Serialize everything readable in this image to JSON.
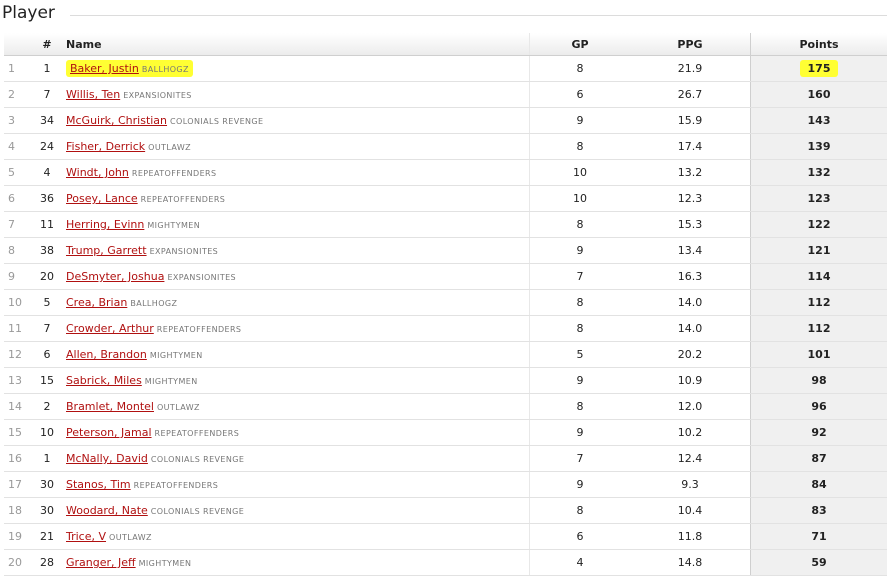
{
  "section": {
    "title": "Player"
  },
  "columns": {
    "idx": "",
    "num": "#",
    "name": "Name",
    "gp": "GP",
    "ppg": "PPG",
    "points": "Points"
  },
  "rows": [
    {
      "idx": "1",
      "num": "1",
      "name": "Baker, Justin",
      "team": "BALLHOGZ",
      "gp": "8",
      "ppg": "21.9",
      "points": "175",
      "highlight": true
    },
    {
      "idx": "2",
      "num": "7",
      "name": "Willis, Ten",
      "team": "EXPANSIONITES",
      "gp": "6",
      "ppg": "26.7",
      "points": "160"
    },
    {
      "idx": "3",
      "num": "34",
      "name": "McGuirk, Christian",
      "team": "COLONIALS REVENGE",
      "gp": "9",
      "ppg": "15.9",
      "points": "143"
    },
    {
      "idx": "4",
      "num": "24",
      "name": "Fisher, Derrick",
      "team": "OUTLAWZ",
      "gp": "8",
      "ppg": "17.4",
      "points": "139"
    },
    {
      "idx": "5",
      "num": "4",
      "name": "Windt, John",
      "team": "REPEATOFFENDERS",
      "gp": "10",
      "ppg": "13.2",
      "points": "132"
    },
    {
      "idx": "6",
      "num": "36",
      "name": "Posey, Lance",
      "team": "REPEATOFFENDERS",
      "gp": "10",
      "ppg": "12.3",
      "points": "123"
    },
    {
      "idx": "7",
      "num": "11",
      "name": "Herring, Evinn",
      "team": "MIGHTYMEN",
      "gp": "8",
      "ppg": "15.3",
      "points": "122"
    },
    {
      "idx": "8",
      "num": "38",
      "name": "Trump, Garrett",
      "team": "EXPANSIONITES",
      "gp": "9",
      "ppg": "13.4",
      "points": "121"
    },
    {
      "idx": "9",
      "num": "20",
      "name": "DeSmyter, Joshua",
      "team": "EXPANSIONITES",
      "gp": "7",
      "ppg": "16.3",
      "points": "114"
    },
    {
      "idx": "10",
      "num": "5",
      "name": "Crea, Brian",
      "team": "BALLHOGZ",
      "gp": "8",
      "ppg": "14.0",
      "points": "112"
    },
    {
      "idx": "11",
      "num": "7",
      "name": "Crowder, Arthur",
      "team": "REPEATOFFENDERS",
      "gp": "8",
      "ppg": "14.0",
      "points": "112"
    },
    {
      "idx": "12",
      "num": "6",
      "name": "Allen, Brandon",
      "team": "MIGHTYMEN",
      "gp": "5",
      "ppg": "20.2",
      "points": "101"
    },
    {
      "idx": "13",
      "num": "15",
      "name": "Sabrick, Miles",
      "team": "MIGHTYMEN",
      "gp": "9",
      "ppg": "10.9",
      "points": "98"
    },
    {
      "idx": "14",
      "num": "2",
      "name": "Bramlet, Montel",
      "team": "OUTLAWZ",
      "gp": "8",
      "ppg": "12.0",
      "points": "96"
    },
    {
      "idx": "15",
      "num": "10",
      "name": "Peterson, Jamal",
      "team": "REPEATOFFENDERS",
      "gp": "9",
      "ppg": "10.2",
      "points": "92"
    },
    {
      "idx": "16",
      "num": "1",
      "name": "McNally, David",
      "team": "COLONIALS REVENGE",
      "gp": "7",
      "ppg": "12.4",
      "points": "87"
    },
    {
      "idx": "17",
      "num": "30",
      "name": "Stanos, Tim",
      "team": "REPEATOFFENDERS",
      "gp": "9",
      "ppg": "9.3",
      "points": "84"
    },
    {
      "idx": "18",
      "num": "30",
      "name": "Woodard, Nate",
      "team": "COLONIALS REVENGE",
      "gp": "8",
      "ppg": "10.4",
      "points": "83"
    },
    {
      "idx": "19",
      "num": "21",
      "name": "Trice, V",
      "team": "OUTLAWZ",
      "gp": "6",
      "ppg": "11.8",
      "points": "71"
    },
    {
      "idx": "20",
      "num": "28",
      "name": "Granger, Jeff",
      "team": "MIGHTYMEN",
      "gp": "4",
      "ppg": "14.8",
      "points": "59"
    }
  ],
  "colors": {
    "link": "#b01010",
    "highlight": "#ffff33",
    "team": "#777777"
  }
}
